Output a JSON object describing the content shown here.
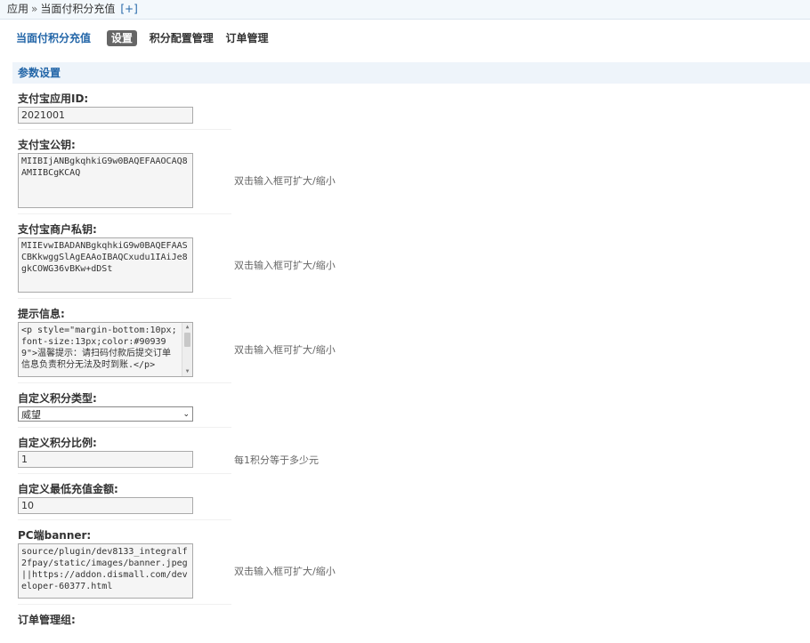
{
  "breadcrumb": {
    "root": "应用",
    "sep": "»",
    "current": "当面付积分充值",
    "add": "[+]"
  },
  "nav": {
    "title": "当面付积分充值",
    "items": [
      {
        "label": "设置",
        "active": true
      },
      {
        "label": "积分配置管理",
        "active": false
      },
      {
        "label": "订单管理",
        "active": false
      }
    ]
  },
  "section": {
    "title": "参数设置"
  },
  "fields": {
    "app_id": {
      "label": "支付宝应用ID:",
      "value": "2021001"
    },
    "public_key": {
      "label": "支付宝公钥:",
      "value": "MIIBIjANBgkqhkiG9w0BAQEFAAOCAQ8AMIIBCgKCAQ",
      "hint": "双击输入框可扩大/缩小"
    },
    "private_key": {
      "label": "支付宝商户私钥:",
      "value": "MIIEvwIBADANBgkqhkiG9w0BAQEFAASCBKkwggSlAgEAAoIBAQCxudu1IAiJe8gkCOWG36vBKw+dDSt",
      "hint": "双击输入框可扩大/缩小"
    },
    "tip": {
      "label": "提示信息:",
      "value": "<p style=\"margin-bottom:10px;font-size:13px;color:#909399\">温馨提示：请扫码付款后提交订单信息负责积分无法及时到账.</p>",
      "hint": "双击输入框可扩大/缩小"
    },
    "credit_type": {
      "label": "自定义积分类型:",
      "value": "威望"
    },
    "credit_ratio": {
      "label": "自定义积分比例:",
      "value": "1",
      "hint": "每1积分等于多少元"
    },
    "min_amount": {
      "label": "自定义最低充值金额:",
      "value": "10"
    },
    "pc_banner": {
      "label": "PC端banner:",
      "value": "source/plugin/dev8133_integralf2fpay/static/images/banner.jpeg||https://addon.dismall.com/developer-60377.html",
      "hint": "双击输入框可扩大/缩小"
    },
    "order_group": {
      "label": "订单管理组:"
    }
  },
  "icons": {
    "scroll_up": "▲",
    "scroll_down": "▼",
    "select_chevron": "⌄"
  }
}
